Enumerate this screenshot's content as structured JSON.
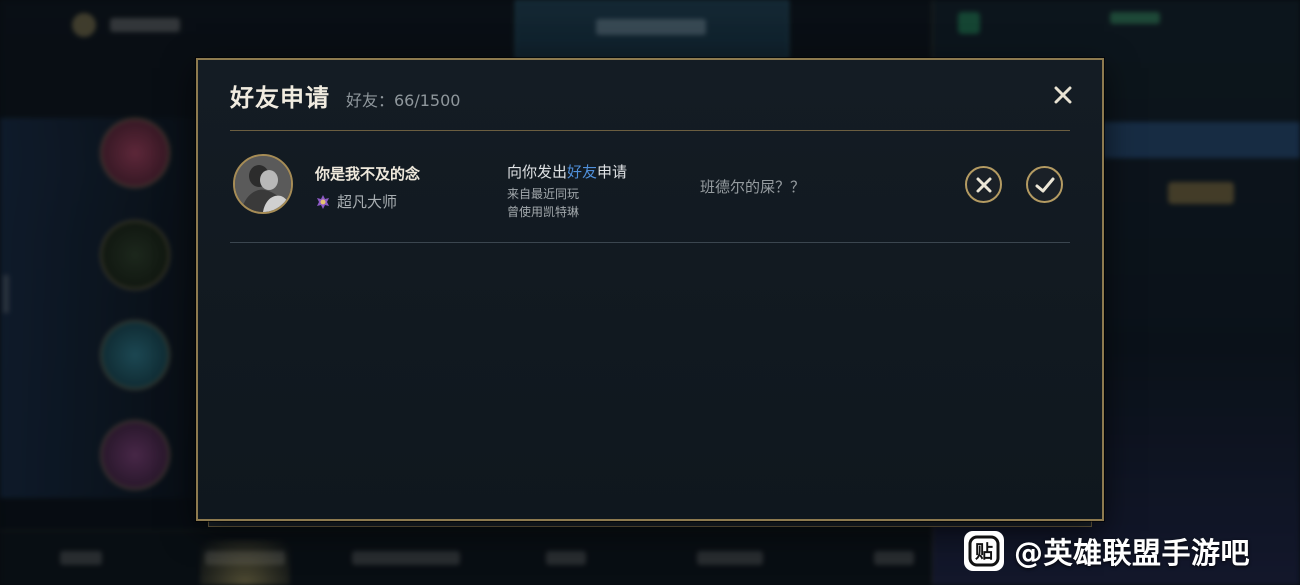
{
  "dialog": {
    "title": "好友申请",
    "friend_count": "好友：66/1500",
    "close_icon": "close-icon"
  },
  "requests": [
    {
      "username": "你是我不及的念",
      "rank_icon": "rank-emblem-icon",
      "rank": "超凡大师",
      "message_prefix": "向你发出",
      "message_highlight": "好友",
      "message_suffix": "申请",
      "source": "来自最近同玩",
      "champion_used": "曾使用凯特琳",
      "note": "班德尔的屎？？",
      "reject_icon": "x-circle-icon",
      "accept_icon": "check-circle-icon"
    }
  ],
  "watermark": {
    "logo_text": "贴",
    "text": "@英雄联盟手游吧"
  },
  "colors": {
    "border_gold": "#8d7a4f",
    "highlight_blue": "#4f8fd9",
    "panel_bg": "#131b22"
  }
}
